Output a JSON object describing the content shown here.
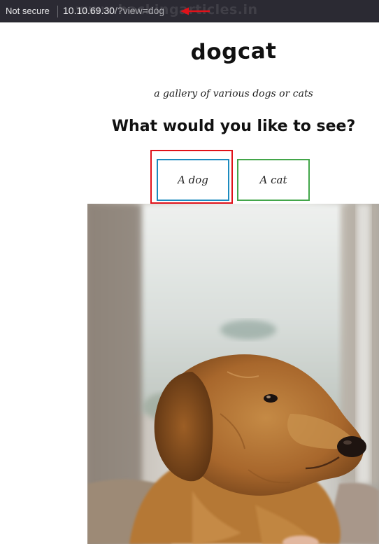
{
  "browser": {
    "security_label": "Not secure",
    "url_host": "10.10.69.30",
    "url_path": "/?view=dog",
    "watermark": "www.hackingarticles.in"
  },
  "page": {
    "title": "dogcat",
    "subtitle": "a gallery of various dogs or cats",
    "question": "What would you like to see?",
    "buttons": {
      "dog": "A dog",
      "cat": "A cat"
    }
  },
  "colors": {
    "addressbar_bg": "#2b2a33",
    "dog_button_border": "#1c8bbf",
    "cat_button_border": "#43a64a",
    "annotation_red": "#e0121a"
  }
}
